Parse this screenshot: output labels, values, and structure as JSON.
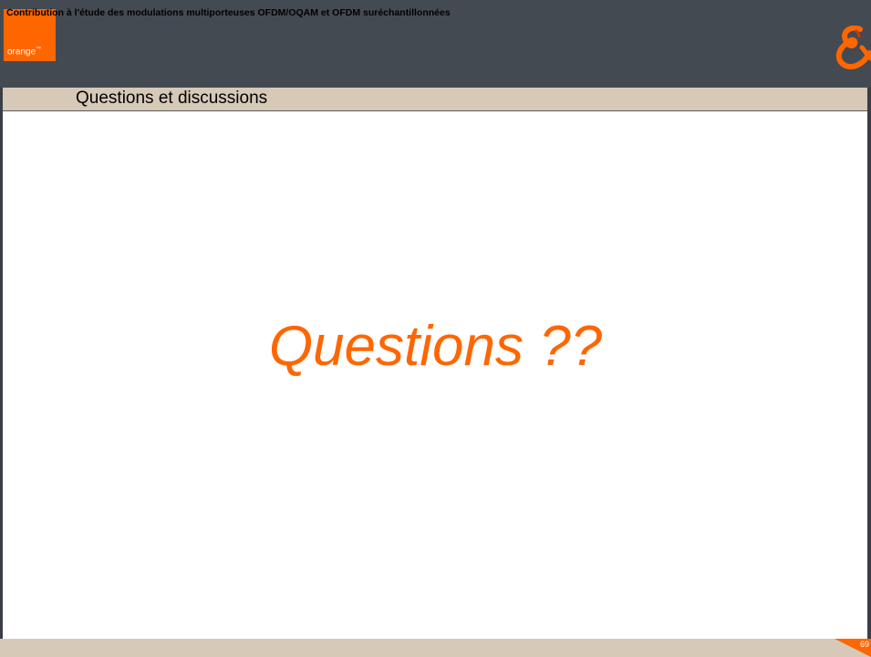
{
  "brand": {
    "logo_text": "orange",
    "logo_trademark": "™",
    "accent_color": "#ff6600",
    "header_color": "#444a52",
    "band_color": "#d6c9b8"
  },
  "header": {
    "section_title": "Questions et discussions"
  },
  "main": {
    "headline": "Questions ??"
  },
  "footer": {
    "caption": "Contribution à l'étude des modulations multiporteuses OFDM/OQAM et OFDM suréchantillonnées",
    "page_number": "69"
  },
  "icons": {
    "top_right": "ampersand-logo-icon"
  }
}
